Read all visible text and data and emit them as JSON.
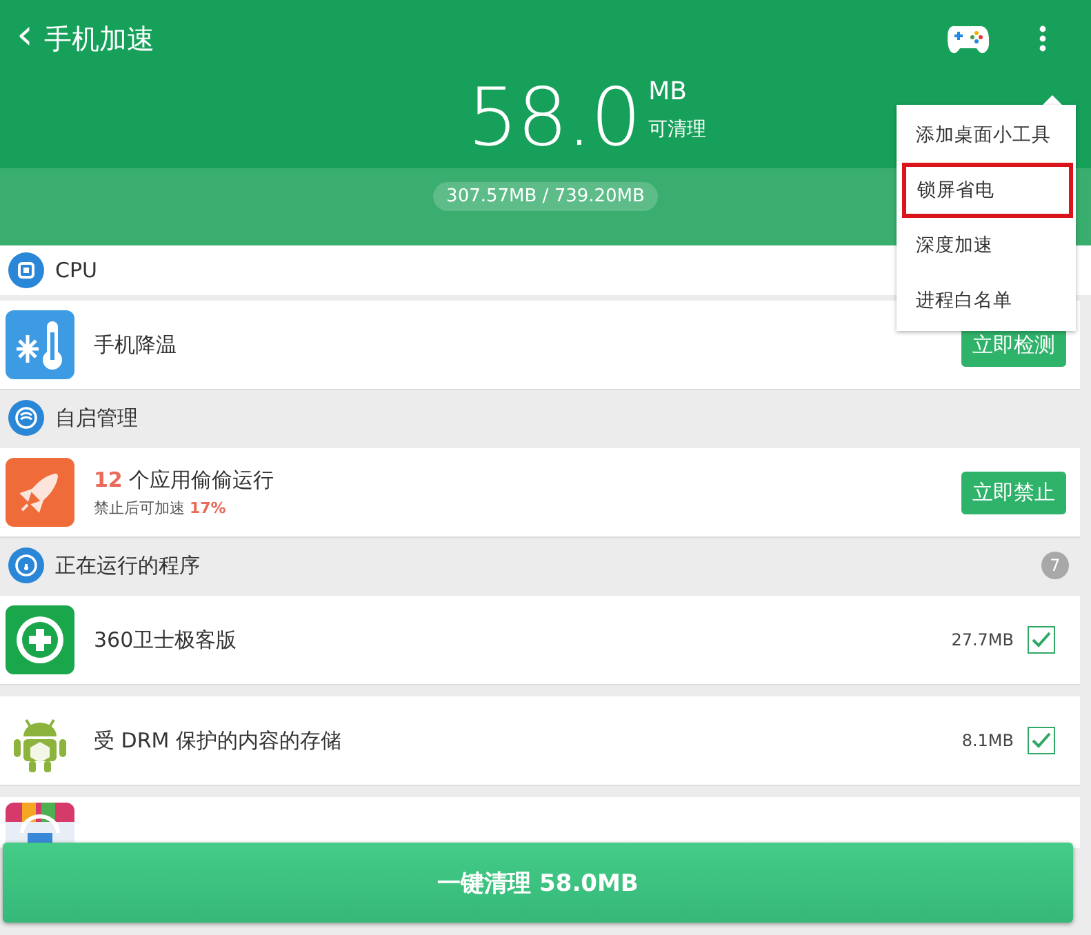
{
  "header": {
    "back": "‹",
    "title": "手机加速",
    "amount": "58.0",
    "unit": "MB",
    "caption": "可清理",
    "memory": "307.57MB / 739.20MB"
  },
  "menu": {
    "items": [
      {
        "label": "添加桌面小工具",
        "highlighted": false
      },
      {
        "label": "锁屏省电",
        "highlighted": true
      },
      {
        "label": "深度加速",
        "highlighted": false
      },
      {
        "label": "进程白名单",
        "highlighted": false
      }
    ]
  },
  "sections": [
    {
      "title": "CPU",
      "items": [
        {
          "kind": "action",
          "title": "手机降温",
          "button": "立即检测"
        }
      ]
    },
    {
      "title": "自启管理",
      "items": [
        {
          "kind": "action",
          "title": "**12** 个应用偷偷运行",
          "subtitle": "禁止后可加速 **17%**",
          "button": "立即禁止"
        }
      ]
    },
    {
      "title": "正在运行的程序",
      "badge": "7",
      "items": [
        {
          "kind": "app",
          "title": "360卫士极客版",
          "size": "27.7MB",
          "checked": true
        },
        {
          "kind": "app",
          "title": "受 DRM 保护的内容的存储",
          "size": "8.1MB",
          "checked": true
        },
        {
          "kind": "partial"
        }
      ]
    }
  ],
  "clean_button": "一键清理 58.0MB"
}
